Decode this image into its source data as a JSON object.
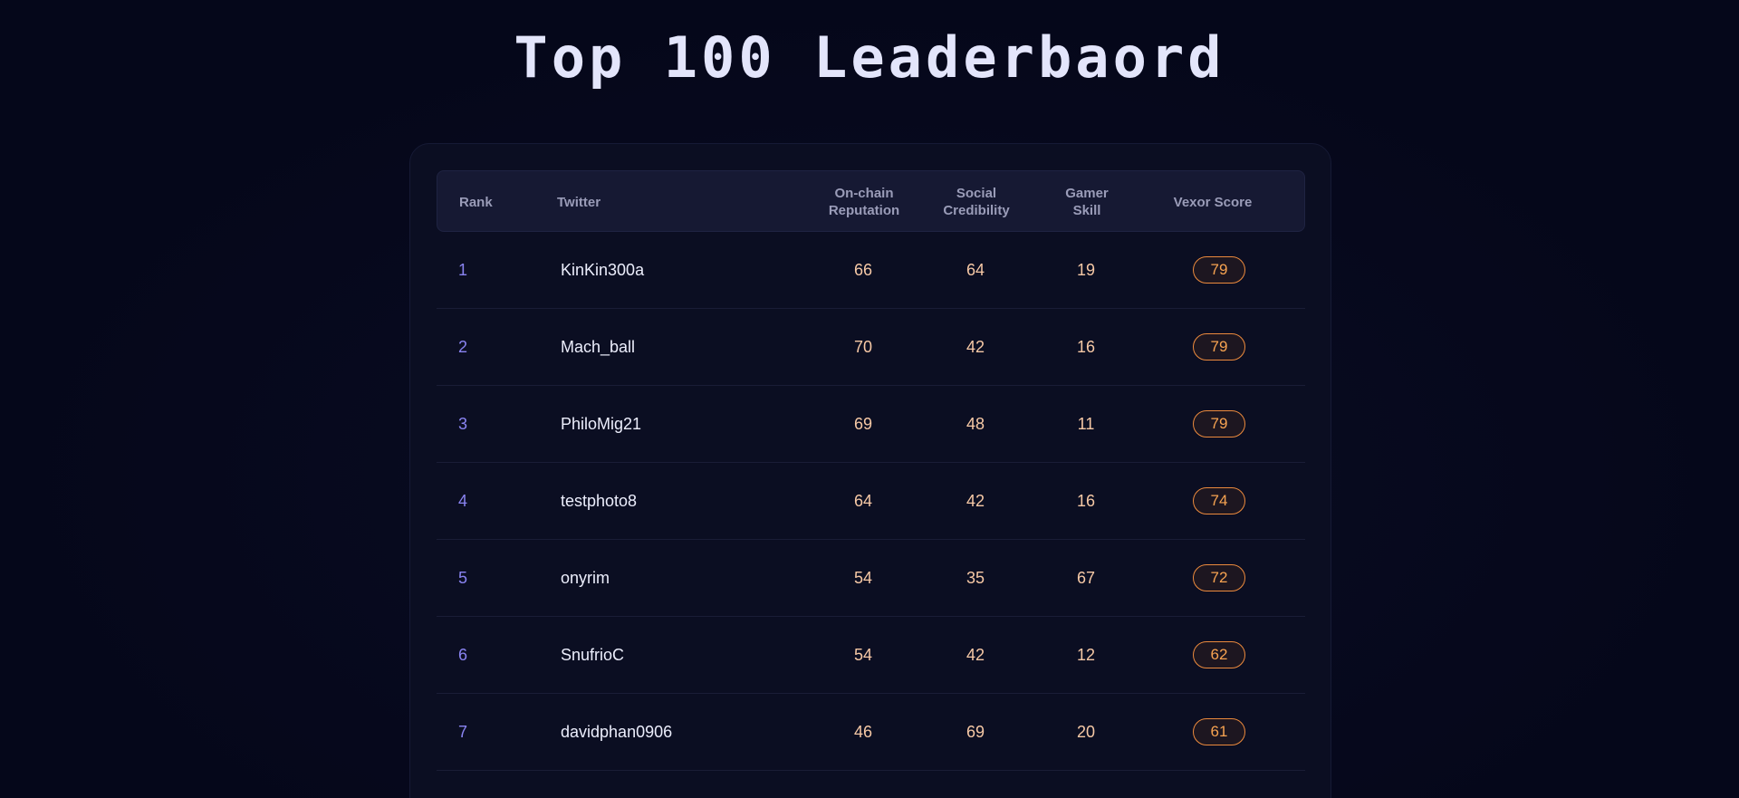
{
  "page": {
    "title": "Top 100 Leaderbaord"
  },
  "table": {
    "headers": {
      "rank": "Rank",
      "twitter": "Twitter",
      "onchain_line1": "On-chain",
      "onchain_line2": "Reputation",
      "social_line1": "Social",
      "social_line2": "Credibility",
      "gamer_line1": "Gamer",
      "gamer_line2": "Skill",
      "vexor": "Vexor Score"
    },
    "rows": [
      {
        "rank": "1",
        "twitter": "KinKin300a",
        "onchain": "66",
        "social": "64",
        "gamer": "19",
        "vexor": "79"
      },
      {
        "rank": "2",
        "twitter": "Mach_ball",
        "onchain": "70",
        "social": "42",
        "gamer": "16",
        "vexor": "79"
      },
      {
        "rank": "3",
        "twitter": "PhiloMig21",
        "onchain": "69",
        "social": "48",
        "gamer": "11",
        "vexor": "79"
      },
      {
        "rank": "4",
        "twitter": "testphoto8",
        "onchain": "64",
        "social": "42",
        "gamer": "16",
        "vexor": "74"
      },
      {
        "rank": "5",
        "twitter": "onyrim",
        "onchain": "54",
        "social": "35",
        "gamer": "67",
        "vexor": "72"
      },
      {
        "rank": "6",
        "twitter": "SnufrioC",
        "onchain": "54",
        "social": "42",
        "gamer": "12",
        "vexor": "62"
      },
      {
        "rank": "7",
        "twitter": "davidphan0906",
        "onchain": "46",
        "social": "69",
        "gamer": "20",
        "vexor": "61"
      }
    ]
  },
  "colors": {
    "background": "#05071a",
    "rank_accent": "#8a84f2",
    "score_accent": "#f7a351",
    "badge_border": "#ec8a3d"
  }
}
